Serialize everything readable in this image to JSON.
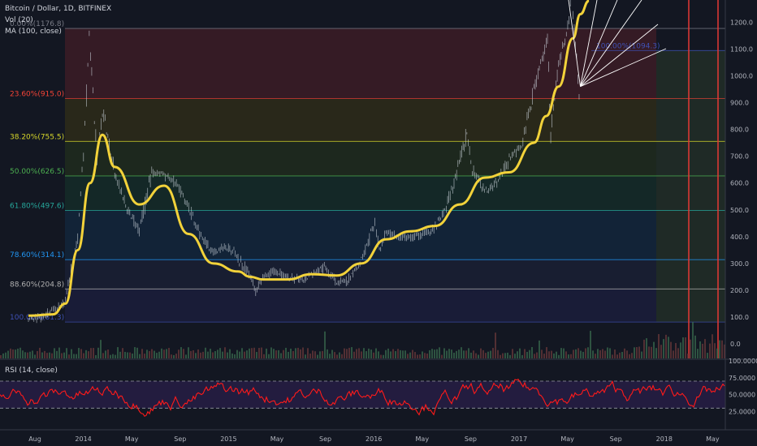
{
  "header": {
    "symbol_line": "Bitcoin / Dollar, 1D, BITFINEX",
    "vol_label": "Vol (20)",
    "ma_label": "MA (100, close)",
    "rsi_label": "RSI (14, close)"
  },
  "chart_data": [
    {
      "type": "line",
      "title": "Bitcoin / Dollar, 1D, BITFINEX",
      "xlabel": "",
      "ylabel": "",
      "ylim": [
        -60,
        1300
      ],
      "x_tick_labels": [
        "Aug",
        "2014",
        "May",
        "Sep",
        "2015",
        "May",
        "Sep",
        "2016",
        "May",
        "Sep",
        "2017",
        "May",
        "Sep",
        "2018",
        "May"
      ],
      "y_tick_labels": [
        "0.0",
        "100.0",
        "200.0",
        "300.0",
        "400.0",
        "500.0",
        "600.0",
        "700.0",
        "800.0",
        "900.0",
        "1000.0",
        "1100.0",
        "1200.0"
      ],
      "y_ticks": [
        0,
        100,
        200,
        300,
        400,
        500,
        600,
        700,
        800,
        900,
        1000,
        1100,
        1200
      ],
      "price_series": {
        "name": "",
        "x": [
          "2013-07",
          "2013-08",
          "2013-09",
          "2013-10",
          "2013-11",
          "2013-11-15",
          "2013-11-29",
          "2013-12-05",
          "2013-12-18",
          "2014-01",
          "2014-02",
          "2014-03",
          "2014-04",
          "2014-05",
          "2014-06",
          "2014-07",
          "2014-08",
          "2014-09",
          "2014-10",
          "2014-11",
          "2014-12",
          "2015-01",
          "2015-01-14",
          "2015-02",
          "2015-03",
          "2015-05",
          "2015-07",
          "2015-08",
          "2015-09",
          "2015-10",
          "2015-11-04",
          "2015-11-15",
          "2015-12",
          "2016-01",
          "2016-02",
          "2016-03",
          "2016-04",
          "2016-05",
          "2016-06-18",
          "2016-07",
          "2016-08",
          "2016-09",
          "2016-10",
          "2016-11",
          "2016-12",
          "2017-01-04",
          "2017-01-12",
          "2017-02",
          "2017-02-20",
          "2017-03-03",
          "2017-03-12",
          "2017-03-24"
        ],
        "values": [
          95,
          100,
          125,
          160,
          400,
          700,
          1160,
          1000,
          700,
          870,
          640,
          500,
          420,
          640,
          630,
          600,
          510,
          400,
          340,
          370,
          320,
          250,
          200,
          250,
          270,
          235,
          285,
          230,
          240,
          310,
          450,
          340,
          420,
          400,
          400,
          410,
          430,
          520,
          780,
          650,
          570,
          600,
          690,
          740,
          950,
          1130,
          780,
          1050,
          1150,
          1300,
          1100,
          890
        ]
      },
      "ma_series": {
        "name": "",
        "x": [
          "2013-07",
          "2013-09",
          "2013-10",
          "2013-11",
          "2013-12",
          "2014-01",
          "2014-02",
          "2014-04",
          "2014-06",
          "2014-08",
          "2014-10",
          "2014-12",
          "2015-01",
          "2015-02",
          "2015-04",
          "2015-06",
          "2015-08",
          "2015-10",
          "2015-12",
          "2016-02",
          "2016-04",
          "2016-06",
          "2016-08",
          "2016-10",
          "2016-12",
          "2017-01",
          "2017-02",
          "2017-03-06",
          "2017-03-24",
          "2017-04-15"
        ],
        "values": [
          105,
          110,
          150,
          350,
          600,
          780,
          660,
          520,
          590,
          410,
          300,
          270,
          250,
          240,
          240,
          260,
          255,
          300,
          390,
          420,
          440,
          520,
          620,
          640,
          750,
          850,
          960,
          1140,
          1230,
          1280
        ]
      },
      "fib_levels": [
        {
          "label": "0.00%(1176.8)",
          "value": 1176.8,
          "color": "#787b86"
        },
        {
          "label": "23.60%(915.0)",
          "value": 915.0,
          "color": "#f44336"
        },
        {
          "label": "38.20%(755.5)",
          "value": 755.5,
          "color": "#d6d62a"
        },
        {
          "label": "50.00%(626.5)",
          "value": 626.5,
          "color": "#4caf50"
        },
        {
          "label": "61.80%(497.6)",
          "value": 497.6,
          "color": "#26a69a"
        },
        {
          "label": "78.60%(314.1)",
          "value": 314.1,
          "color": "#2196f3"
        },
        {
          "label": "88.60%(204.8)",
          "value": 204.8,
          "color": "#b0b0b0"
        },
        {
          "label": "100.00%(81.3)",
          "value": 81.3,
          "color": "#3f51b5"
        },
        {
          "label": "100.00%(1094.3)",
          "value": 1094.3,
          "color": "#3f51b5"
        }
      ],
      "colors": {
        "price": "#c9d1d9",
        "ma": "#f2d23a",
        "background": "#131722"
      }
    },
    {
      "type": "line",
      "title": "RSI (14, close)",
      "xlabel": "",
      "ylabel": "",
      "ylim": [
        10,
        100
      ],
      "y_tick_labels": [
        "100.0000",
        "75.0000",
        "50.0000",
        "25.0000"
      ],
      "y_ticks": [
        100,
        75,
        50,
        25
      ],
      "upper_band": 70,
      "lower_band": 30,
      "colors": {
        "rsi": "#ff1a1a",
        "band_fill": "#2a1f4a"
      }
    }
  ]
}
